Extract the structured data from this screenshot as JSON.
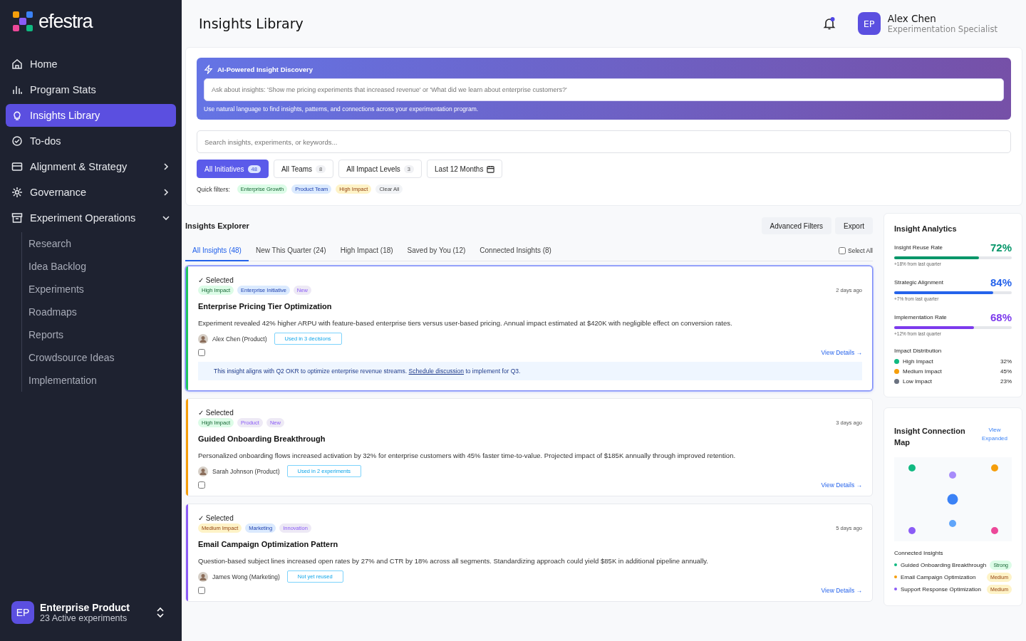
{
  "brand": {
    "name": "efestra"
  },
  "sidebar": {
    "items": [
      {
        "label": "Home",
        "kind": "home",
        "selected": false
      },
      {
        "label": "Program Stats",
        "kind": "stats",
        "selected": false
      },
      {
        "label": "Insights Library",
        "kind": "bulb",
        "selected": true
      },
      {
        "label": "To-dos",
        "kind": "check",
        "selected": false
      },
      {
        "label": "Alignment & Strategy",
        "kind": "board",
        "selected": false,
        "expanded": false
      },
      {
        "label": "Governance",
        "kind": "gear",
        "selected": false,
        "expanded": false
      },
      {
        "label": "Experiment Operations",
        "kind": "archive",
        "selected": false,
        "expanded": true,
        "children": [
          {
            "label": "Research",
            "selected": false
          },
          {
            "label": "Idea Backlog",
            "selected": false
          },
          {
            "label": "Experiments",
            "selected": false
          },
          {
            "label": "Roadmaps",
            "selected": false
          },
          {
            "label": "Reports",
            "selected": false
          },
          {
            "label": "Crowdsource Ideas",
            "selected": false
          },
          {
            "label": "Implementation",
            "selected": false
          }
        ]
      }
    ],
    "workspace": {
      "initials": "EP",
      "name": "Enterprise Product",
      "subtitle": "23 Active experiments"
    }
  },
  "header": {
    "title": "Insights Library",
    "notification_unread": true,
    "user": {
      "initials": "EP",
      "name": "Alex Chen",
      "role": "Experimentation Specialist"
    }
  },
  "ai_discovery": {
    "title": "AI-Powered Insight Discovery",
    "placeholder": "Ask about insights: 'Show me pricing experiments that increased revenue' or 'What did we learn about enterprise customers?'",
    "hint": "Use natural language to find insights, patterns, and connections across your experimentation program."
  },
  "search": {
    "placeholder": "Search insights, experiments, or keywords..."
  },
  "filters": [
    {
      "label": "All Initiatives",
      "kind": "count",
      "count": "48",
      "selected": true
    },
    {
      "label": "All Teams",
      "kind": "count",
      "count": "8",
      "selected": false
    },
    {
      "label": "All Impact Levels",
      "kind": "count",
      "count": "3",
      "selected": false
    },
    {
      "label": "Last 12 Months",
      "kind": "date",
      "selected": false
    }
  ],
  "quick_filters": {
    "label": "Quick filters:",
    "chips": [
      {
        "label": "Enterprise Growth",
        "kind": "green"
      },
      {
        "label": "Product Team",
        "kind": "blue"
      },
      {
        "label": "High Impact",
        "kind": "amber"
      },
      {
        "label": "Clear All",
        "kind": "plain"
      }
    ]
  },
  "explorer": {
    "title": "Insights Explorer",
    "actions": [
      "Advanced Filters",
      "Export"
    ],
    "tabs": [
      {
        "label": "All Insights (48)",
        "selected": true
      },
      {
        "label": "New This Quarter (24)",
        "selected": false
      },
      {
        "label": "High Impact (18)",
        "selected": false
      },
      {
        "label": "Saved by You (12)",
        "selected": false
      },
      {
        "label": "Connected Insights (8)",
        "selected": false
      }
    ],
    "select_all": {
      "label": "Select All",
      "checked": false
    },
    "insights": [
      {
        "highlighted": true,
        "color": "#22c55e",
        "status": "✓ Selected",
        "tags": [
          {
            "label": "High Impact",
            "kind": "green"
          },
          {
            "label": "Enterprise Initiative",
            "kind": "blue"
          },
          {
            "label": "New",
            "kind": "purple"
          }
        ],
        "age": "2 days ago",
        "title": "Enterprise Pricing Tier Optimization",
        "summary": "Experiment revealed 42% higher ARPU with feature-based enterprise tiers versus user-based pricing. Annual impact estimated at $420K with negligible effect on conversion rates.",
        "author": "Alex Chen (Product)",
        "usage": "Used in 3 decisions",
        "checked": false,
        "link": "View Details →",
        "note": {
          "before": "This insight aligns with Q2 OKR to optimize enterprise revenue streams.",
          "link": "Schedule discussion",
          "after": "to implement for Q3."
        }
      },
      {
        "highlighted": false,
        "color": "#f59e0b",
        "status": "✓ Selected",
        "tags": [
          {
            "label": "High Impact",
            "kind": "green"
          },
          {
            "label": "Product",
            "kind": "purple"
          },
          {
            "label": "New",
            "kind": "purple"
          }
        ],
        "age": "3 days ago",
        "title": "Guided Onboarding Breakthrough",
        "summary": "Personalized onboarding flows increased activation by 32% for enterprise customers with 45% faster time-to-value. Projected impact of $185K annually through improved retention.",
        "author": "Sarah Johnson (Product)",
        "usage": "Used in 2 experiments",
        "checked": false,
        "link": "View Details →"
      },
      {
        "highlighted": false,
        "color": "#8b5cf6",
        "status": "✓ Selected",
        "tags": [
          {
            "label": "Medium Impact",
            "kind": "amber"
          },
          {
            "label": "Marketing",
            "kind": "blue"
          },
          {
            "label": "Innovation",
            "kind": "purple"
          }
        ],
        "age": "5 days ago",
        "title": "Email Campaign Optimization Pattern",
        "summary": "Question-based subject lines increased open rates by 27% and CTR by 18% across all segments. Standardizing approach could yield $85K in additional pipeline annually.",
        "author": "James Wong (Marketing)",
        "usage": "Not yet reused",
        "checked": false,
        "link": "View Details →"
      }
    ]
  },
  "analytics": {
    "title": "Insight Analytics",
    "metrics": [
      {
        "name": "Insight Reuse Rate",
        "value": "72%",
        "level": 0.72,
        "color": "#059669",
        "change": "+18% from last quarter"
      },
      {
        "name": "Strategic Alignment",
        "value": "84%",
        "level": 0.84,
        "color": "#2563eb",
        "change": "+7% from last quarter"
      },
      {
        "name": "Implementation Rate",
        "value": "68%",
        "level": 0.68,
        "color": "#7c3aed",
        "change": "+12% from last quarter"
      }
    ],
    "distribution": {
      "title": "Impact Distribution",
      "items": [
        {
          "label": "High Impact",
          "value": "32%",
          "color": "#10b981"
        },
        {
          "label": "Medium Impact",
          "value": "45%",
          "color": "#f59e0b"
        },
        {
          "label": "Low Impact",
          "value": "23%",
          "color": "#6b7280"
        }
      ]
    }
  },
  "connection_map": {
    "title": "Insight Connection Map",
    "link": "View Expanded",
    "connected_title": "Connected Insights",
    "connected": [
      {
        "label": "Guided Onboarding Breakthrough",
        "color": "#10b981",
        "strength": "Strong",
        "kind": "strong"
      },
      {
        "label": "Email Campaign Optimization",
        "color": "#f59e0b",
        "strength": "Medium",
        "kind": "medium"
      },
      {
        "label": "Support Response Optimization",
        "color": "#8b5cf6",
        "strength": "Medium",
        "kind": "medium"
      }
    ]
  }
}
